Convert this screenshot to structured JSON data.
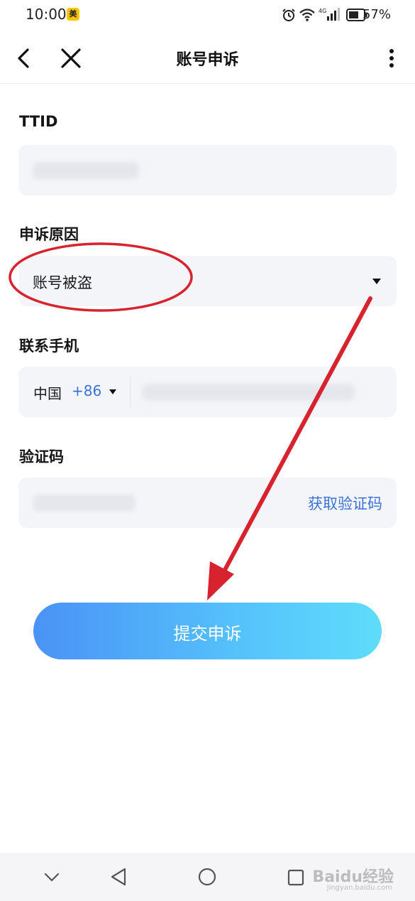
{
  "status_bar": {
    "time": "10:00",
    "app_badge": "美",
    "battery": "57%"
  },
  "nav": {
    "title": "账号申诉"
  },
  "form": {
    "ttid": {
      "label": "TTID"
    },
    "reason": {
      "label": "申诉原因",
      "value": "账号被盗"
    },
    "phone": {
      "label": "联系手机",
      "country": "中国",
      "dial_code": "+86"
    },
    "code": {
      "label": "验证码",
      "get_code": "获取验证码"
    }
  },
  "submit": {
    "label": "提交申诉"
  },
  "watermark": {
    "brand": "Baidu经验",
    "url": "jingyan.baidu.com"
  },
  "colors": {
    "accent": "#3a72d8",
    "annotation": "#d8232e",
    "field_bg": "#f4f5f9"
  }
}
